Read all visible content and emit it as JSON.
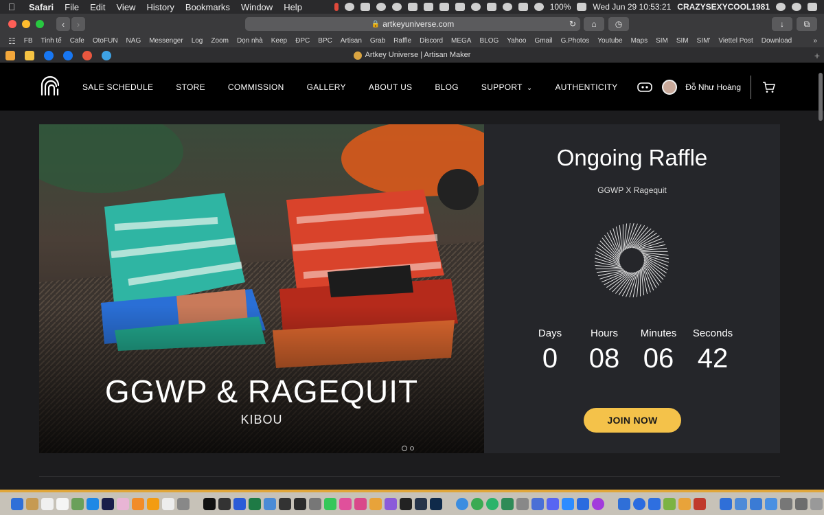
{
  "menubar": {
    "items": [
      "Safari",
      "File",
      "Edit",
      "View",
      "History",
      "Bookmarks",
      "Window",
      "Help"
    ],
    "battery": "100%",
    "datetime": "Wed Jun 29  10:53:21",
    "username": "CRAZYSEXYCOOL1981"
  },
  "toolbar": {
    "url": "artkeyuniverse.com"
  },
  "favorites": [
    "FB",
    "Tinh tế",
    "Cafe",
    "OtoFUN",
    "NAG",
    "Messenger",
    "Log",
    "Zoom",
    "Dọn nhà",
    "Keep",
    "ĐPC",
    "BPC",
    "Artisan",
    "Grab",
    "Raffle",
    "Discord",
    "MEGA",
    "BLOG",
    "Yahoo",
    "Gmail",
    "G.Photos",
    "Youtube",
    "Maps",
    "SIM",
    "SIM",
    "SIM'",
    "Viettel Post",
    "Download"
  ],
  "tab": {
    "title": "Artkey Universe | Artisan Maker"
  },
  "site": {
    "nav": [
      "SALE SCHEDULE",
      "STORE",
      "COMMISSION",
      "GALLERY",
      "ABOUT US",
      "BLOG",
      "SUPPORT",
      "AUTHENTICITY"
    ],
    "user_name": "Đỗ Như Hoàng",
    "hero_title": "GGWP & RAGEQUIT",
    "hero_subtitle": "KIBOU",
    "raffle": {
      "title": "Ongoing Raffle",
      "subtitle": "GGWP X Ragequit",
      "labels": [
        "Days",
        "Hours",
        "Minutes",
        "Seconds"
      ],
      "values": [
        "0",
        "08",
        "06",
        "42"
      ],
      "button": "JOIN NOW"
    }
  },
  "colors": {
    "accent": "#f4c24a",
    "panel": "#25262a",
    "nav_bg": "#000000"
  }
}
